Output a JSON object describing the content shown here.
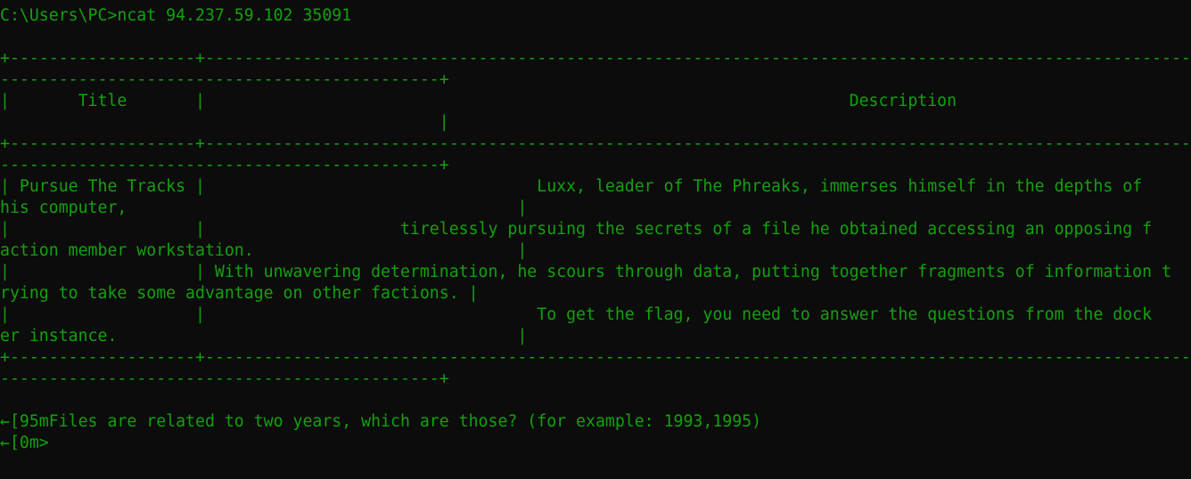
{
  "terminal": {
    "prompt_line": "C:\\Users\\PC>ncat 94.237.59.102 35091",
    "table": {
      "border_top_a": "+-------------------+-----------------------------------------------------------------------------------------------------------",
      "border_top_b": "---------------------------------------------+",
      "header_a": "|       Title       |                                                                  Description",
      "header_b": "                                             |",
      "border_mid_a": "+-------------------+-----------------------------------------------------------------------------------------------------------",
      "border_mid_b": "---------------------------------------------+",
      "rows": [
        "| Pursue The Tracks |                                  Luxx, leader of The Phreaks, immerses himself in the depths of",
        "his computer,                                        |",
        "|                   |                    tirelessly pursuing the secrets of a file he obtained accessing an opposing f",
        "action member workstation.                           |",
        "|                   | With unwavering determination, he scours through data, putting together fragments of information t",
        "rying to take some advantage on other factions. |",
        "|                   |                                  To get the flag, you need to answer the questions from the dock",
        "er instance.                                         |"
      ],
      "border_bottom_a": "+-------------------+-----------------------------------------------------------------------------------------------------------",
      "border_bottom_b": "---------------------------------------------+"
    },
    "question_line": "←[95mFiles are related to two years, which are those? (for example: 1993,1995)",
    "input_line": "←[0m>"
  }
}
